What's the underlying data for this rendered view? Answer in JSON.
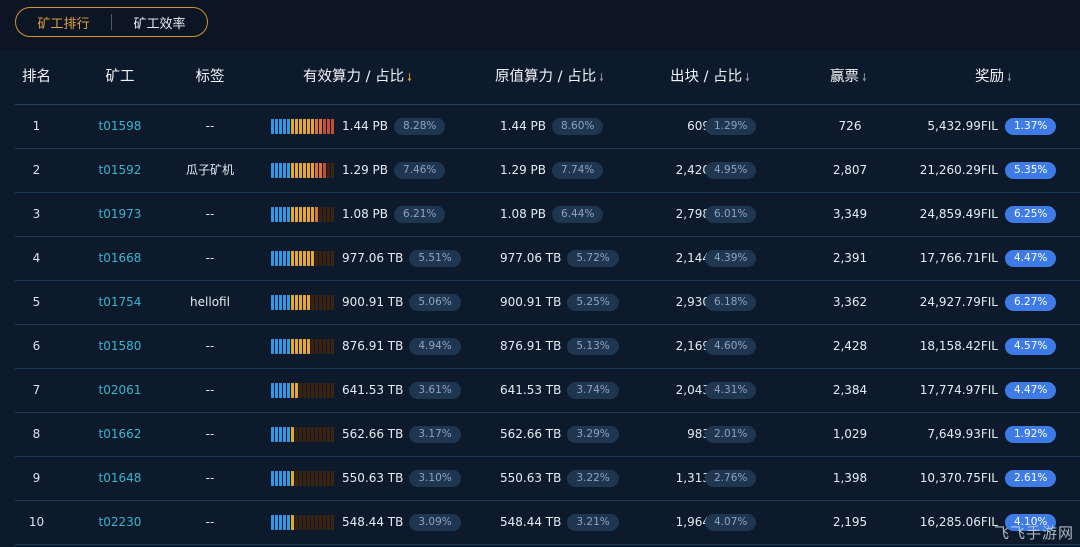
{
  "tabs": [
    {
      "label": "矿工排行",
      "active": true
    },
    {
      "label": "矿工效率",
      "active": false
    }
  ],
  "columns": {
    "rank": "排名",
    "miner": "矿工",
    "tag": "标签",
    "effective_power": "有效算力 / 占比",
    "raw_power": "原值算力 / 占比",
    "blocks": "出块 / 占比",
    "tickets": "赢票",
    "rewards": "奖励"
  },
  "sort_arrow": "🠗",
  "rows": [
    {
      "rank": "1",
      "miner": "t01598",
      "tag": "--",
      "eff": "1.44 PB",
      "eff_pct": "8.28%",
      "raw": "1.44 PB",
      "raw_pct": "8.60%",
      "blocks": "609",
      "blocks_pct": "1.29%",
      "tickets": "726",
      "reward": "5,432.99FIL",
      "reward_pct": "1.37%",
      "eff_fraction": 1.0
    },
    {
      "rank": "2",
      "miner": "t01592",
      "tag": "瓜子矿机",
      "eff": "1.29 PB",
      "eff_pct": "7.46%",
      "raw": "1.29 PB",
      "raw_pct": "7.74%",
      "blocks": "2,420",
      "blocks_pct": "4.95%",
      "tickets": "2,807",
      "reward": "21,260.29FIL",
      "reward_pct": "5.35%",
      "eff_fraction": 0.9
    },
    {
      "rank": "3",
      "miner": "t01973",
      "tag": "--",
      "eff": "1.08 PB",
      "eff_pct": "6.21%",
      "raw": "1.08 PB",
      "raw_pct": "6.44%",
      "blocks": "2,798",
      "blocks_pct": "6.01%",
      "tickets": "3,349",
      "reward": "24,859.49FIL",
      "reward_pct": "6.25%",
      "eff_fraction": 0.75
    },
    {
      "rank": "4",
      "miner": "t01668",
      "tag": "--",
      "eff": "977.06 TB",
      "eff_pct": "5.51%",
      "raw": "977.06 TB",
      "raw_pct": "5.72%",
      "blocks": "2,144",
      "blocks_pct": "4.39%",
      "tickets": "2,391",
      "reward": "17,766.71FIL",
      "reward_pct": "4.47%",
      "eff_fraction": 0.66
    },
    {
      "rank": "5",
      "miner": "t01754",
      "tag": "hellofil",
      "eff": "900.91 TB",
      "eff_pct": "5.06%",
      "raw": "900.91 TB",
      "raw_pct": "5.25%",
      "blocks": "2,930",
      "blocks_pct": "6.18%",
      "tickets": "3,362",
      "reward": "24,927.79FIL",
      "reward_pct": "6.27%",
      "eff_fraction": 0.61
    },
    {
      "rank": "6",
      "miner": "t01580",
      "tag": "--",
      "eff": "876.91 TB",
      "eff_pct": "4.94%",
      "raw": "876.91 TB",
      "raw_pct": "5.13%",
      "blocks": "2,169",
      "blocks_pct": "4.60%",
      "tickets": "2,428",
      "reward": "18,158.42FIL",
      "reward_pct": "4.57%",
      "eff_fraction": 0.6
    },
    {
      "rank": "7",
      "miner": "t02061",
      "tag": "--",
      "eff": "641.53 TB",
      "eff_pct": "3.61%",
      "raw": "641.53 TB",
      "raw_pct": "3.74%",
      "blocks": "2,043",
      "blocks_pct": "4.31%",
      "tickets": "2,384",
      "reward": "17,774.97FIL",
      "reward_pct": "4.47%",
      "eff_fraction": 0.44
    },
    {
      "rank": "8",
      "miner": "t01662",
      "tag": "--",
      "eff": "562.66 TB",
      "eff_pct": "3.17%",
      "raw": "562.66 TB",
      "raw_pct": "3.29%",
      "blocks": "983",
      "blocks_pct": "2.01%",
      "tickets": "1,029",
      "reward": "7,649.93FIL",
      "reward_pct": "1.92%",
      "eff_fraction": 0.38
    },
    {
      "rank": "9",
      "miner": "t01648",
      "tag": "--",
      "eff": "550.63 TB",
      "eff_pct": "3.10%",
      "raw": "550.63 TB",
      "raw_pct": "3.22%",
      "blocks": "1,313",
      "blocks_pct": "2.76%",
      "tickets": "1,398",
      "reward": "10,370.75FIL",
      "reward_pct": "2.61%",
      "eff_fraction": 0.37
    },
    {
      "rank": "10",
      "miner": "t02230",
      "tag": "--",
      "eff": "548.44 TB",
      "eff_pct": "3.09%",
      "raw": "548.44 TB",
      "raw_pct": "3.21%",
      "blocks": "1,964",
      "blocks_pct": "4.07%",
      "tickets": "2,195",
      "reward": "16,285.06FIL",
      "reward_pct": "4.10%",
      "eff_fraction": 0.37
    }
  ],
  "bar_colors": {
    "blue": "#2f9be8",
    "yellow": "#e6a92a",
    "orange": "#d9743a",
    "red": "#c4503c",
    "dim": "#3a2410"
  },
  "watermark": "飞飞手游网"
}
